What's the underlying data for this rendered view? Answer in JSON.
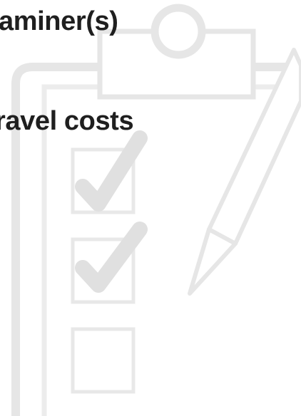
{
  "document": {
    "lines": [
      "aminer(s)",
      "ravel costs"
    ]
  },
  "illustration": {
    "icon_name": "clipboard-checklist-icon",
    "colors": {
      "outline": "#e6e6e6",
      "check": "#e0e0e0"
    },
    "checklist": [
      {
        "checked": true
      },
      {
        "checked": true
      },
      {
        "checked": false
      }
    ]
  }
}
